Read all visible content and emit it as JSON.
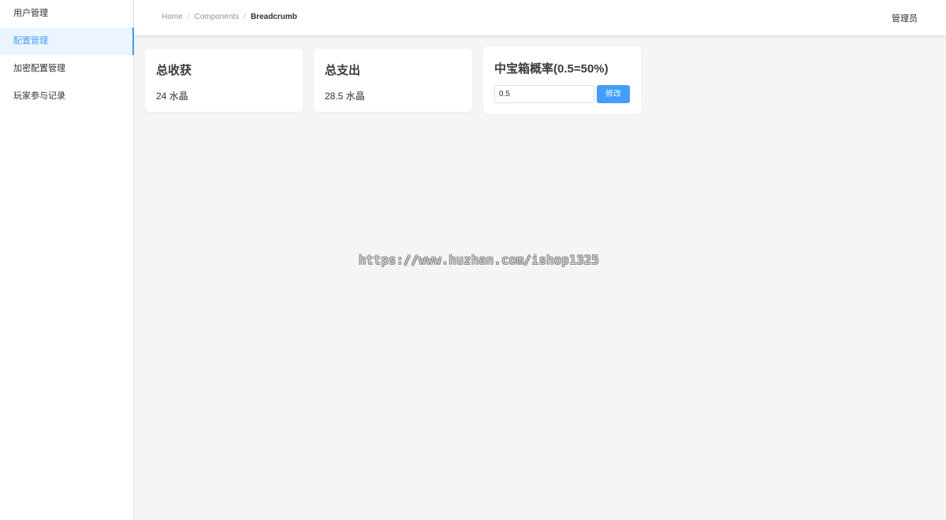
{
  "sidebar": {
    "items": [
      {
        "label": "用户管理",
        "active": false
      },
      {
        "label": "配置管理",
        "active": true
      },
      {
        "label": "加密配置管理",
        "active": false
      },
      {
        "label": "玩家参与记录",
        "active": false
      }
    ]
  },
  "header": {
    "breadcrumb": [
      "Home",
      "Components",
      "Breadcrumb"
    ],
    "user": "管理员"
  },
  "cards": {
    "income": {
      "title": "总收获",
      "value": "24 水晶"
    },
    "expense": {
      "title": "总支出",
      "value": "28.5 水晶"
    },
    "probability": {
      "title": "中宝箱概率(0.5=50%)",
      "input_value": "0.5",
      "button_label": "修改"
    }
  },
  "watermark": "https://www.huzhan.com/ishop1325",
  "colors": {
    "accent": "#409eff",
    "background": "#f4f5f7"
  }
}
